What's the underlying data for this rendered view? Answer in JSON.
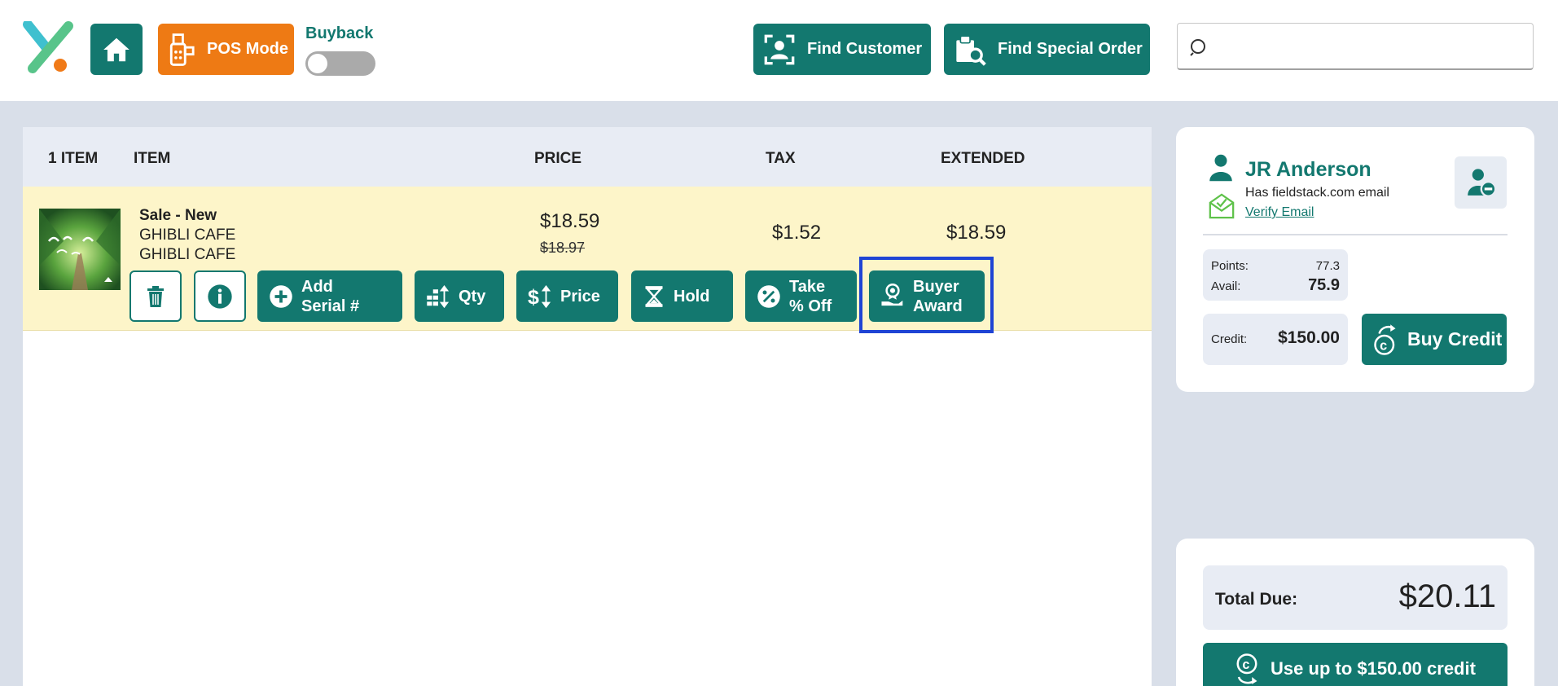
{
  "header": {
    "pos_mode_label": "POS Mode",
    "buyback_label": "Buyback",
    "buyback_on": false,
    "find_customer_label": "Find Customer",
    "find_special_order_label": "Find Special Order",
    "search_value": ""
  },
  "cart": {
    "columns": {
      "count": "1 ITEM",
      "item": "ITEM",
      "price": "PRICE",
      "tax": "TAX",
      "extended": "EXTENDED"
    },
    "items": [
      {
        "type": "Sale - New",
        "title": "GHIBLI CAFE",
        "subtitle": "GHIBLI CAFE",
        "price": "$18.59",
        "original_price": "$18.97",
        "tax": "$1.52",
        "extended": "$18.59",
        "actions": {
          "add_serial": "Add Serial #",
          "qty": "Qty",
          "price": "Price",
          "hold": "Hold",
          "take_off": "Take % Off",
          "buyer_award": "Buyer Award"
        }
      }
    ]
  },
  "customer": {
    "name": "JR Anderson",
    "email_status": "Has fieldstack.com email",
    "verify_label": "Verify Email",
    "points_label": "Points:",
    "points_value": "77.3",
    "avail_label": "Avail:",
    "avail_value": "75.9",
    "credit_label": "Credit:",
    "credit_value": "$150.00",
    "buy_credit_label": "Buy Credit"
  },
  "totals": {
    "total_label": "Total Due:",
    "total_value": "$20.11",
    "use_credit_label": "Use up to $150.00 credit"
  },
  "colors": {
    "teal": "#13786f",
    "orange": "#ee7a14",
    "row_highlight": "#fdf5c9",
    "focus_outline": "#1f44d4"
  }
}
